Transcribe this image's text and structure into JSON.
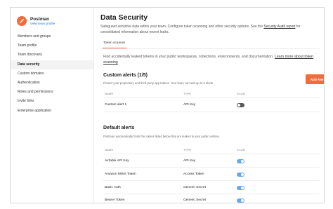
{
  "sidebar": {
    "brand_name": "Postman",
    "brand_link": "View team profile",
    "items": [
      {
        "label": "Members and groups"
      },
      {
        "label": "Team profile"
      },
      {
        "label": "Team discovery"
      },
      {
        "label": "Data security",
        "active": true
      },
      {
        "label": "Custom domains"
      },
      {
        "label": "Authentication"
      },
      {
        "label": "Roles and permissions"
      },
      {
        "label": "Invite links"
      },
      {
        "label": "Enterprise application"
      }
    ]
  },
  "main": {
    "title": "Data Security",
    "subtitle_prefix": "Safeguard sensitive data within your team. Configure token scanning and other security options.",
    "subtitle_mid": "See the ",
    "subtitle_link": "Security Audit report",
    "subtitle_suffix": " for consolidated information about recent leaks.",
    "tab": "Token scanner",
    "description": "Find accidentally leaked tokens in your public workspaces, collections, environments, and documentation.",
    "description_link": "Learn more about token scanning"
  },
  "custom_alerts": {
    "title": "Custom alerts (1/5)",
    "description": "Protect your proprietary and third-party app tokens. Your team can add up to 5 alerts",
    "add_button": "Add Alert",
    "columns": {
      "name": "NAME",
      "type": "TYPE",
      "scan": "SCAN"
    },
    "rows": [
      {
        "name": "Custom alert 1",
        "type": "API Key",
        "scan": false
      }
    ]
  },
  "default_alerts": {
    "title": "Default alerts",
    "description": "Postman automatically finds the tokens listed below that are leaked in your public entities.",
    "columns": {
      "name": "NAME",
      "type": "TYPE",
      "scan": "SCAN"
    },
    "rows": [
      {
        "name": "Airtable API Key",
        "type": "API Key",
        "scan": true
      },
      {
        "name": "Amazon MWS Token",
        "type": "Access Token",
        "scan": true
      },
      {
        "name": "Basic Auth",
        "type": "Generic Secret",
        "scan": true
      },
      {
        "name": "Bearer Token",
        "type": "Generic Secret",
        "scan": true
      }
    ]
  },
  "colors": {
    "accent": "#f26b3a",
    "toggle_on": "#6ba6ea",
    "toggle_off": "#5a5a5a",
    "link": "#097bed"
  }
}
